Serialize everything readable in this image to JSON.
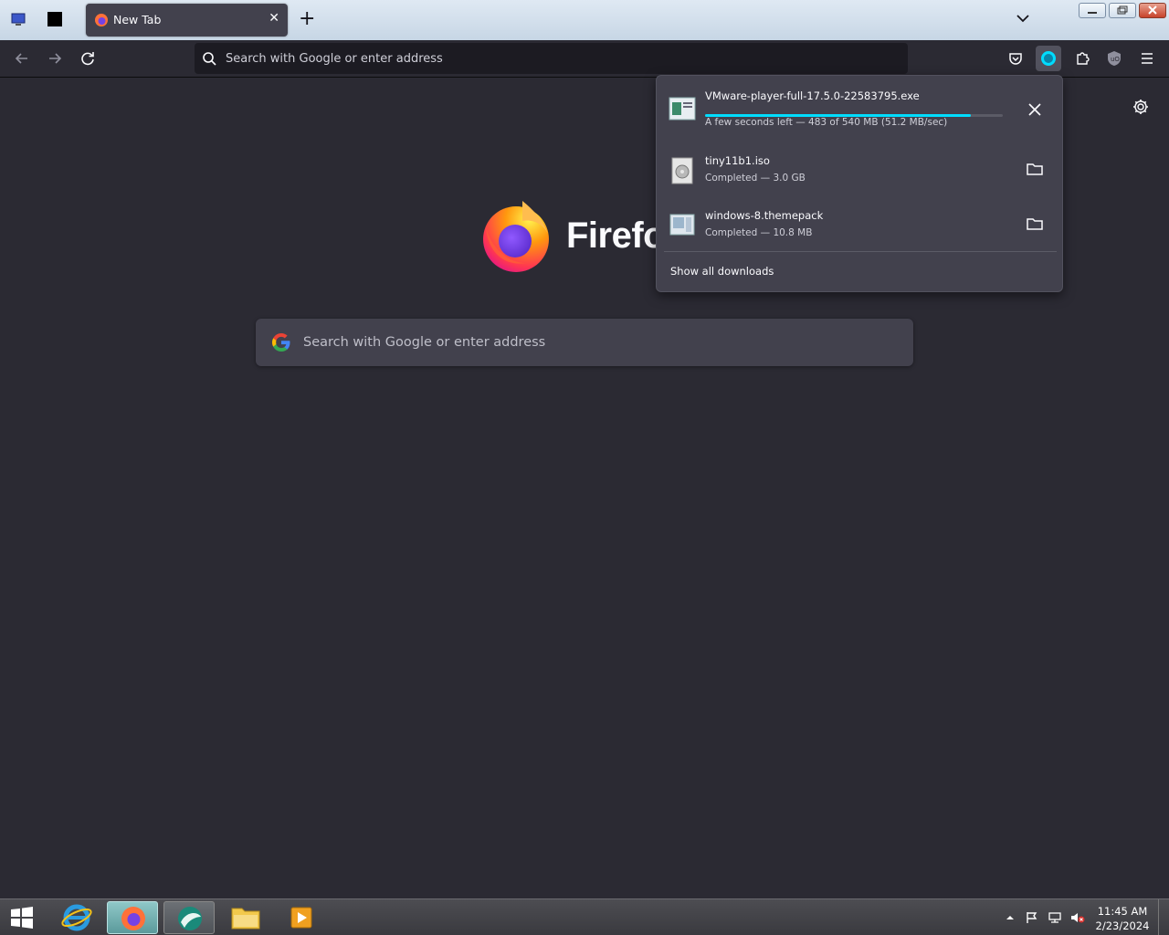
{
  "tab": {
    "title": "New Tab",
    "close": "✕"
  },
  "newtab_label": "+",
  "urlbar": {
    "placeholder": "Search with Google or enter address"
  },
  "content": {
    "brand_wordmark": "Firefox",
    "search_placeholder": "Search with Google or enter address"
  },
  "downloads": {
    "items": [
      {
        "name": "VMware-player-full-17.5.0-22583795.exe",
        "status": "A few seconds left — 483 of 540 MB (51.2 MB/sec)",
        "progress": 0.894,
        "action_icon": "close-icon"
      },
      {
        "name": "tiny11b1.iso",
        "status": "Completed — 3.0 GB",
        "action_icon": "folder-icon"
      },
      {
        "name": "windows-8.themepack",
        "status": "Completed — 10.8 MB",
        "action_icon": "folder-icon"
      }
    ],
    "show_all": "Show all downloads"
  },
  "taskbar": {
    "time": "11:45 AM",
    "date": "2/23/2024"
  },
  "colors": {
    "accent": "#00ddff",
    "page_bg": "#2b2a33",
    "panel_bg": "#42414d"
  }
}
